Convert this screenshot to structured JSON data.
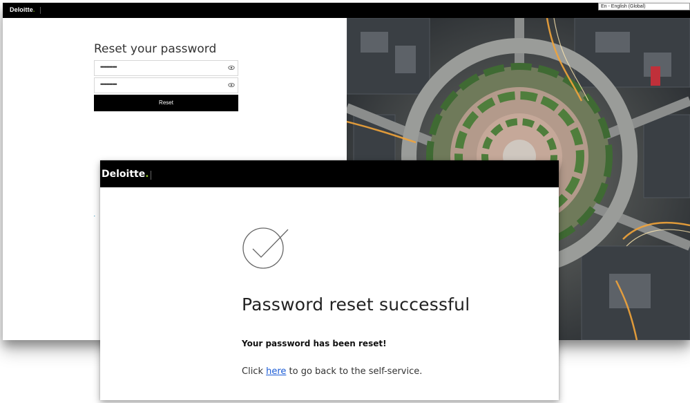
{
  "back_page": {
    "logo": "Deloitte",
    "logo_dot": ".",
    "language": "En - English (Global)",
    "title": "Reset your password",
    "new_password_value": "•••••••••••",
    "confirm_password_value": "•••••••••••",
    "reset_button": "Reset"
  },
  "dialog": {
    "logo": "Deloitte",
    "logo_dot": ".",
    "title": "Password reset successful",
    "subtitle": "Your password has been reset!",
    "link_prefix": "Click ",
    "link_text": "here",
    "link_suffix": " to go back to the self-service."
  },
  "colors": {
    "brand_black": "#000000",
    "brand_green": "#86bc25",
    "link_blue": "#1a5bd6"
  },
  "icons": [
    "eye-icon",
    "checkmark-circle-icon"
  ]
}
